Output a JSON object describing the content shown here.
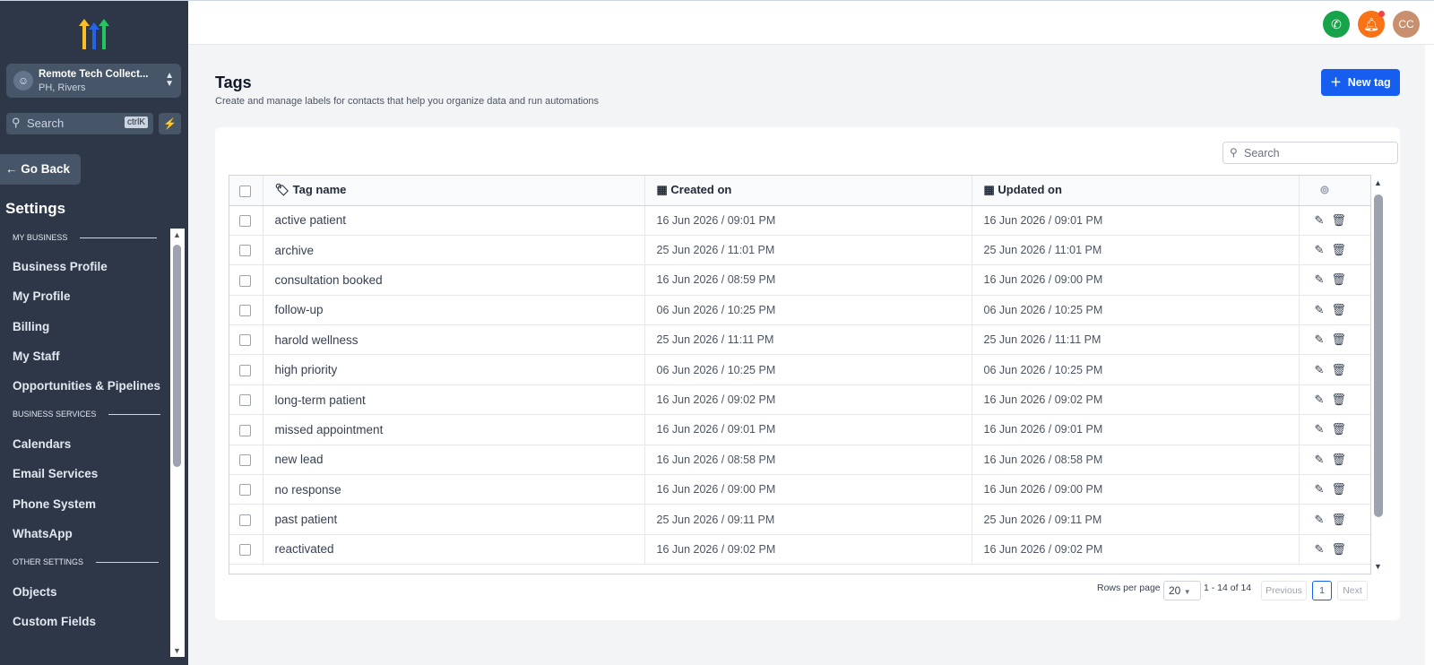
{
  "sidebar": {
    "account": {
      "name": "Remote Tech Collect...",
      "location": "PH, Rivers"
    },
    "search": {
      "placeholder": "Search",
      "shortcut": "ctrlK"
    },
    "go_back": "Go Back",
    "heading": "Settings",
    "sections": [
      {
        "label": "MY BUSINESS",
        "items": [
          "Business Profile",
          "My Profile",
          "Billing",
          "My Staff",
          "Opportunities & Pipelines"
        ]
      },
      {
        "label": "BUSINESS SERVICES",
        "items": [
          "Calendars",
          "Email Services",
          "Phone System",
          "WhatsApp"
        ]
      },
      {
        "label": "OTHER SETTINGS",
        "items": [
          "Objects",
          "Custom Fields"
        ]
      }
    ]
  },
  "topbar": {
    "avatar_initials": "CC",
    "colors": {
      "phone": "#16a34a",
      "bell": "#f97316",
      "avatar": "#c8906e"
    }
  },
  "page": {
    "title": "Tags",
    "subtitle": "Create and manage labels for contacts that help you organize data and run automations",
    "new_tag_label": "New tag"
  },
  "table": {
    "search_placeholder": "Search",
    "columns": {
      "name": "Tag name",
      "created": "Created on",
      "updated": "Updated on"
    },
    "rows": [
      {
        "name": "active patient",
        "created": "16 Jun 2026 / 09:01 PM",
        "updated": "16 Jun 2026 / 09:01 PM"
      },
      {
        "name": "archive",
        "created": "25 Jun 2026 / 11:01 PM",
        "updated": "25 Jun 2026 / 11:01 PM"
      },
      {
        "name": "consultation booked",
        "created": "16 Jun 2026 / 08:59 PM",
        "updated": "16 Jun 2026 / 09:00 PM"
      },
      {
        "name": "follow-up",
        "created": "06 Jun 2026 / 10:25 PM",
        "updated": "06 Jun 2026 / 10:25 PM"
      },
      {
        "name": "harold wellness",
        "created": "25 Jun 2026 / 11:11 PM",
        "updated": "25 Jun 2026 / 11:11 PM"
      },
      {
        "name": "high priority",
        "created": "06 Jun 2026 / 10:25 PM",
        "updated": "06 Jun 2026 / 10:25 PM"
      },
      {
        "name": "long-term patient",
        "created": "16 Jun 2026 / 09:02 PM",
        "updated": "16 Jun 2026 / 09:02 PM"
      },
      {
        "name": "missed appointment",
        "created": "16 Jun 2026 / 09:01 PM",
        "updated": "16 Jun 2026 / 09:01 PM"
      },
      {
        "name": "new lead",
        "created": "16 Jun 2026 / 08:58 PM",
        "updated": "16 Jun 2026 / 08:58 PM"
      },
      {
        "name": "no response",
        "created": "16 Jun 2026 / 09:00 PM",
        "updated": "16 Jun 2026 / 09:00 PM"
      },
      {
        "name": "past patient",
        "created": "25 Jun 2026 / 09:11 PM",
        "updated": "25 Jun 2026 / 09:11 PM"
      },
      {
        "name": "reactivated",
        "created": "16 Jun 2026 / 09:02 PM",
        "updated": "16 Jun 2026 / 09:02 PM"
      }
    ]
  },
  "pagination": {
    "rows_per_page_label": "Rows per page",
    "rows_per_page_value": "20",
    "range": "1 - 14 of 14",
    "previous": "Previous",
    "current_page": "1",
    "next": "Next"
  }
}
